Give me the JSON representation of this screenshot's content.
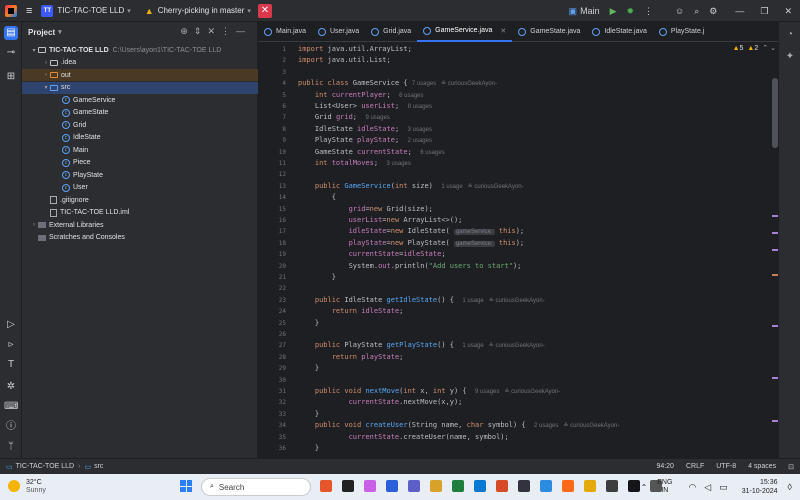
{
  "titlebar": {
    "menu_icon": "hamburger-icon",
    "project_badge": "TT",
    "project_name": "TIC-TAC-TOE LLD",
    "branch_text": "Cherry-picking in master",
    "close_icon": "close-icon",
    "run_config": "Main",
    "right_icons": [
      "run-icon",
      "debug-icon",
      "more-icon",
      "user-icon",
      "search-icon",
      "settings-icon",
      "minimize-icon",
      "restore-icon",
      "close-window-icon"
    ]
  },
  "leftbar": {
    "icons": [
      "project-icon",
      "commit-icon",
      "structure-icon",
      "run-tool-icon",
      "build-icon",
      "maven-icon",
      "debug-tool-icon",
      "terminal-icon",
      "problems-icon",
      "git-icon"
    ]
  },
  "project_panel": {
    "title": "Project",
    "tree": [
      {
        "indent": 0,
        "arrow": "v",
        "icon": "fold",
        "label": "TIC-TAC-TOE LLD",
        "path": "C:\\Users\\ayon1\\TIC-TAC-TOE LLD",
        "bold": true
      },
      {
        "indent": 1,
        "arrow": ">",
        "icon": "fold",
        "label": ".idea"
      },
      {
        "indent": 1,
        "arrow": ">",
        "icon": "fold-or",
        "label": "out",
        "hl": true
      },
      {
        "indent": 1,
        "arrow": "v",
        "icon": "fold-bl",
        "label": "src",
        "sel": true
      },
      {
        "indent": 2,
        "icon": "class",
        "label": "GameService"
      },
      {
        "indent": 2,
        "icon": "class",
        "label": "GameState"
      },
      {
        "indent": 2,
        "icon": "class",
        "label": "Grid"
      },
      {
        "indent": 2,
        "icon": "class",
        "label": "IdleState"
      },
      {
        "indent": 2,
        "icon": "class",
        "label": "Main"
      },
      {
        "indent": 2,
        "icon": "class",
        "label": "Piece"
      },
      {
        "indent": 2,
        "icon": "class",
        "label": "PlayState"
      },
      {
        "indent": 2,
        "icon": "class",
        "label": "User"
      },
      {
        "indent": 1,
        "icon": "file",
        "label": ".gitignore"
      },
      {
        "indent": 1,
        "icon": "file",
        "label": "TIC-TAC-TOE LLD.iml"
      },
      {
        "indent": 0,
        "arrow": ">",
        "icon": "lib",
        "label": "External Libraries"
      },
      {
        "indent": 0,
        "icon": "lib",
        "label": "Scratches and Consoles"
      }
    ]
  },
  "tabs": [
    {
      "label": "Main.java"
    },
    {
      "label": "User.java"
    },
    {
      "label": "Grid.java"
    },
    {
      "label": "GameService.java",
      "active": true
    },
    {
      "label": "GameState.java"
    },
    {
      "label": "IdleState.java"
    },
    {
      "label": "PlayState.j"
    }
  ],
  "inspections": {
    "warnings": "5",
    "weak_warnings": "2"
  },
  "code": [
    {
      "n": "1",
      "t": [
        [
          "kw",
          "import "
        ],
        [
          "tx",
          "java.util.ArrayList;"
        ]
      ]
    },
    {
      "n": "2",
      "t": [
        [
          "kw",
          "import "
        ],
        [
          "tx",
          "java.util.List;"
        ]
      ]
    },
    {
      "n": "3",
      "t": []
    },
    {
      "n": "4",
      "t": [
        [
          "kw",
          "public class "
        ],
        [
          "tx",
          "GameService { "
        ],
        [
          "hn",
          "7 usages   ≗ curiousGeekAyon-"
        ]
      ]
    },
    {
      "n": "5",
      "t": [
        [
          "tx",
          "    "
        ],
        [
          "kw",
          "int "
        ],
        [
          "fd",
          "currentPlayer"
        ],
        [
          "tx",
          ";  "
        ],
        [
          "hn",
          "6 usages"
        ]
      ]
    },
    {
      "n": "6",
      "t": [
        [
          "tx",
          "    List<User> "
        ],
        [
          "fd",
          "userList"
        ],
        [
          "tx",
          ";  "
        ],
        [
          "hn",
          "8 usages"
        ]
      ]
    },
    {
      "n": "7",
      "t": [
        [
          "tx",
          "    Grid "
        ],
        [
          "fd",
          "grid"
        ],
        [
          "tx",
          ";  "
        ],
        [
          "hn",
          "9 usages"
        ]
      ]
    },
    {
      "n": "8",
      "t": [
        [
          "tx",
          "    IdleState "
        ],
        [
          "fd",
          "idleState"
        ],
        [
          "tx",
          ";  "
        ],
        [
          "hn",
          "3 usages"
        ]
      ]
    },
    {
      "n": "9",
      "t": [
        [
          "tx",
          "    PlayState "
        ],
        [
          "fd",
          "playState"
        ],
        [
          "tx",
          ";  "
        ],
        [
          "hn",
          "2 usages"
        ]
      ]
    },
    {
      "n": "10",
      "t": [
        [
          "tx",
          "    GameState "
        ],
        [
          "fd",
          "currentState"
        ],
        [
          "tx",
          ";  "
        ],
        [
          "hn",
          "6 usages"
        ]
      ]
    },
    {
      "n": "11",
      "t": [
        [
          "tx",
          "    "
        ],
        [
          "kw",
          "int "
        ],
        [
          "fd",
          "totalMoves"
        ],
        [
          "tx",
          ";  "
        ],
        [
          "hn",
          "3 usages"
        ]
      ]
    },
    {
      "n": "12",
      "t": []
    },
    {
      "n": "13",
      "t": [
        [
          "tx",
          "    "
        ],
        [
          "kw",
          "public "
        ],
        [
          "fn",
          "GameService"
        ],
        [
          "tx",
          "("
        ],
        [
          "kw",
          "int "
        ],
        [
          "tx",
          "size)  "
        ],
        [
          "hn",
          "1 usage   ≗ curiousGeekAyon-"
        ]
      ]
    },
    {
      "n": "14",
      "t": [
        [
          "tx",
          "        {"
        ]
      ]
    },
    {
      "n": "15",
      "t": [
        [
          "tx",
          "            "
        ],
        [
          "fd",
          "grid"
        ],
        [
          "tx",
          "="
        ],
        [
          "kw",
          "new "
        ],
        [
          "tx",
          "Grid(size);"
        ]
      ]
    },
    {
      "n": "16",
      "t": [
        [
          "tx",
          "            "
        ],
        [
          "fd",
          "userList"
        ],
        [
          "tx",
          "="
        ],
        [
          "kw",
          "new "
        ],
        [
          "tx",
          "ArrayList<>();"
        ]
      ]
    },
    {
      "n": "17",
      "t": [
        [
          "tx",
          "            "
        ],
        [
          "fd",
          "idleState"
        ],
        [
          "tx",
          "="
        ],
        [
          "kw",
          "new "
        ],
        [
          "tx",
          "IdleState( "
        ],
        [
          "pill",
          "gameService:"
        ],
        [
          "kw",
          " this"
        ],
        [
          "tx",
          ");"
        ]
      ]
    },
    {
      "n": "18",
      "t": [
        [
          "tx",
          "            "
        ],
        [
          "fd",
          "playState"
        ],
        [
          "tx",
          "="
        ],
        [
          "kw",
          "new "
        ],
        [
          "tx",
          "PlayState( "
        ],
        [
          "pill",
          "gameService:"
        ],
        [
          "kw",
          " this"
        ],
        [
          "tx",
          ");"
        ]
      ]
    },
    {
      "n": "19",
      "t": [
        [
          "tx",
          "            "
        ],
        [
          "fd",
          "currentState"
        ],
        [
          "tx",
          "="
        ],
        [
          "fd",
          "idleState"
        ],
        [
          "tx",
          ";"
        ]
      ]
    },
    {
      "n": "20",
      "t": [
        [
          "tx",
          "            System."
        ],
        [
          "fd",
          "out"
        ],
        [
          "tx",
          ".println("
        ],
        [
          "st",
          "\"Add users to start\""
        ],
        [
          "tx",
          ");"
        ]
      ]
    },
    {
      "n": "21",
      "t": [
        [
          "tx",
          "        }"
        ]
      ]
    },
    {
      "n": "22",
      "t": []
    },
    {
      "n": "23",
      "t": [
        [
          "tx",
          "    "
        ],
        [
          "kw",
          "public "
        ],
        [
          "tx",
          "IdleState "
        ],
        [
          "fn",
          "getIdleState"
        ],
        [
          "tx",
          "() {  "
        ],
        [
          "hn",
          "1 usage   ≗ curiousGeekAyon-"
        ]
      ]
    },
    {
      "n": "24",
      "t": [
        [
          "tx",
          "        "
        ],
        [
          "kw",
          "return "
        ],
        [
          "fd",
          "idleState"
        ],
        [
          "tx",
          ";"
        ]
      ]
    },
    {
      "n": "25",
      "t": [
        [
          "tx",
          "    }"
        ]
      ]
    },
    {
      "n": "26",
      "t": []
    },
    {
      "n": "27",
      "t": [
        [
          "tx",
          "    "
        ],
        [
          "kw",
          "public "
        ],
        [
          "tx",
          "PlayState "
        ],
        [
          "fn",
          "getPlayState"
        ],
        [
          "tx",
          "() {  "
        ],
        [
          "hn",
          "1 usage   ≗ curiousGeekAyon-"
        ]
      ]
    },
    {
      "n": "28",
      "t": [
        [
          "tx",
          "        "
        ],
        [
          "kw",
          "return "
        ],
        [
          "fd",
          "playState"
        ],
        [
          "tx",
          ";"
        ]
      ]
    },
    {
      "n": "29",
      "t": [
        [
          "tx",
          "    }"
        ]
      ]
    },
    {
      "n": "30",
      "t": []
    },
    {
      "n": "31",
      "t": [
        [
          "tx",
          "    "
        ],
        [
          "kw",
          "public void "
        ],
        [
          "fn",
          "nextMove"
        ],
        [
          "tx",
          "("
        ],
        [
          "kw",
          "int "
        ],
        [
          "tx",
          "x, "
        ],
        [
          "kw",
          "int "
        ],
        [
          "tx",
          "y) {  "
        ],
        [
          "hn",
          "9 usages   ≗ curiousGeekAyon-"
        ]
      ]
    },
    {
      "n": "32",
      "t": [
        [
          "tx",
          "            "
        ],
        [
          "fd",
          "currentState"
        ],
        [
          "tx",
          ".nextMove(x,y);"
        ]
      ]
    },
    {
      "n": "33",
      "t": [
        [
          "tx",
          "    }"
        ]
      ]
    },
    {
      "n": "34",
      "t": [
        [
          "tx",
          "    "
        ],
        [
          "kw",
          "public void "
        ],
        [
          "fn",
          "createUser"
        ],
        [
          "tx",
          "(String name, "
        ],
        [
          "kw",
          "char "
        ],
        [
          "tx",
          "symbol) {  "
        ],
        [
          "hn",
          "2 usages   ≗ curiousGeekAyon-"
        ]
      ]
    },
    {
      "n": "35",
      "t": [
        [
          "tx",
          "            "
        ],
        [
          "fd",
          "currentState"
        ],
        [
          "tx",
          ".createUser(name, symbol);"
        ]
      ]
    },
    {
      "n": "36",
      "t": [
        [
          "tx",
          "    }"
        ]
      ]
    }
  ],
  "statusbar": {
    "crumb_project": "TIC-TAC-TOE LLD",
    "crumb_folder": "src",
    "position": "94:20",
    "line_sep": "CRLF",
    "encoding": "UTF-8",
    "indent": "4 spaces"
  },
  "taskbar": {
    "temp": "32°C",
    "weather": "Sunny",
    "search_placeholder": "Search",
    "lang1": "ENG",
    "lang2": "IN",
    "time": "15:36",
    "date": "31-10-2024",
    "app_colors": [
      "#e6562a",
      "#222222",
      "#c860e8",
      "#2b5fd9",
      "#5b5fc7",
      "#d7a12a",
      "#1e7d3c",
      "#0b78d4",
      "#d74b2a",
      "#33333f",
      "#2c8ce0",
      "#ff6a1a",
      "#e5a90c",
      "#3d3d3d",
      "#16161a",
      "#555555"
    ]
  }
}
